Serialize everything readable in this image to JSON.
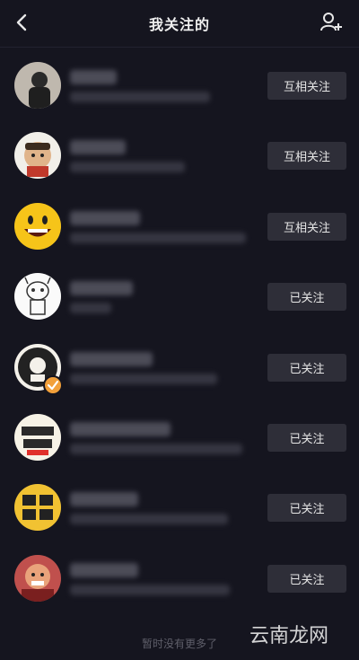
{
  "header": {
    "title": "我关注的"
  },
  "rows": [
    {
      "button": "互相关注"
    },
    {
      "button": "互相关注"
    },
    {
      "button": "互相关注"
    },
    {
      "button": "已关注"
    },
    {
      "button": "已关注"
    },
    {
      "button": "已关注"
    },
    {
      "button": "已关注"
    },
    {
      "button": "已关注"
    }
  ],
  "footer": {
    "text": "暂时没有更多了"
  },
  "watermark": {
    "text": "云南龙网"
  },
  "colors": {
    "background": "#15151f",
    "button_bg": "#2e2e38",
    "verified_badge": "#f2a03a"
  }
}
